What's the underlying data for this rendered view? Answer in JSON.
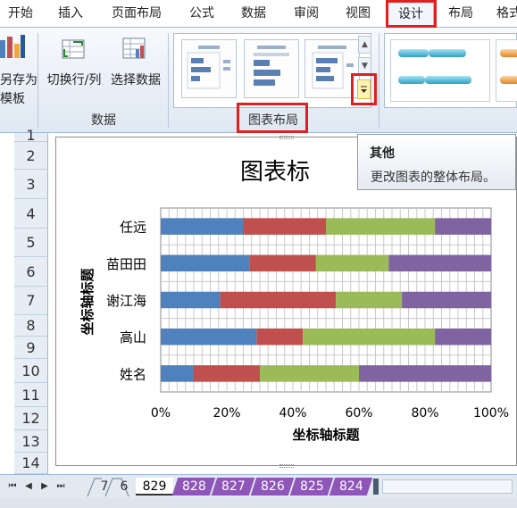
{
  "tabs": [
    "开始",
    "插入",
    "页面布局",
    "公式",
    "数据",
    "审阅",
    "视图",
    "设计",
    "布局",
    "格式"
  ],
  "active_tab": "设计",
  "ribbon": {
    "save_template_line1": "另存为",
    "save_template_line2": "模板",
    "switch_row_col": "切换行/列",
    "select_data": "选择数据",
    "data_group_label": "数据",
    "chart_layouts_group_label": "图表布局"
  },
  "tooltip": {
    "title": "其他",
    "body": "更改图表的整体布局。"
  },
  "row_numbers": [
    "1",
    "2",
    "3",
    "4",
    "5",
    "6",
    "7",
    "8",
    "9",
    "10",
    "11",
    "12",
    "13",
    "14"
  ],
  "sheet_tabs": [
    "7",
    "6",
    "829",
    "828",
    "827",
    "826",
    "825",
    "824"
  ],
  "active_sheet": "829",
  "colors": {
    "series1": "#4f81bd",
    "series2": "#c0504d",
    "series3": "#9bbb59",
    "series4": "#8064a2",
    "highlight": "#e02020",
    "sheet_tab_purple": "#8d56b8"
  },
  "chart_data": {
    "type": "bar",
    "stacked": "100%",
    "orientation": "horizontal",
    "title": "图表标",
    "xlabel": "坐标轴标题",
    "ylabel": "坐标轴标题",
    "categories": [
      "任远",
      "苗田田",
      "谢江海",
      "高山",
      "姓名"
    ],
    "series": [
      {
        "color": "#4f81bd",
        "values": [
          25,
          27,
          18,
          29,
          10
        ]
      },
      {
        "color": "#c0504d",
        "values": [
          25,
          20,
          35,
          14,
          20
        ]
      },
      {
        "color": "#9bbb59",
        "values": [
          33,
          22,
          20,
          40,
          30
        ]
      },
      {
        "color": "#8064a2",
        "values": [
          17,
          31,
          27,
          17,
          40
        ]
      }
    ],
    "xticks": [
      "0%",
      "20%",
      "40%",
      "60%",
      "80%",
      "100%"
    ],
    "xlim": [
      0,
      100
    ],
    "grid": true,
    "legend": "none"
  }
}
